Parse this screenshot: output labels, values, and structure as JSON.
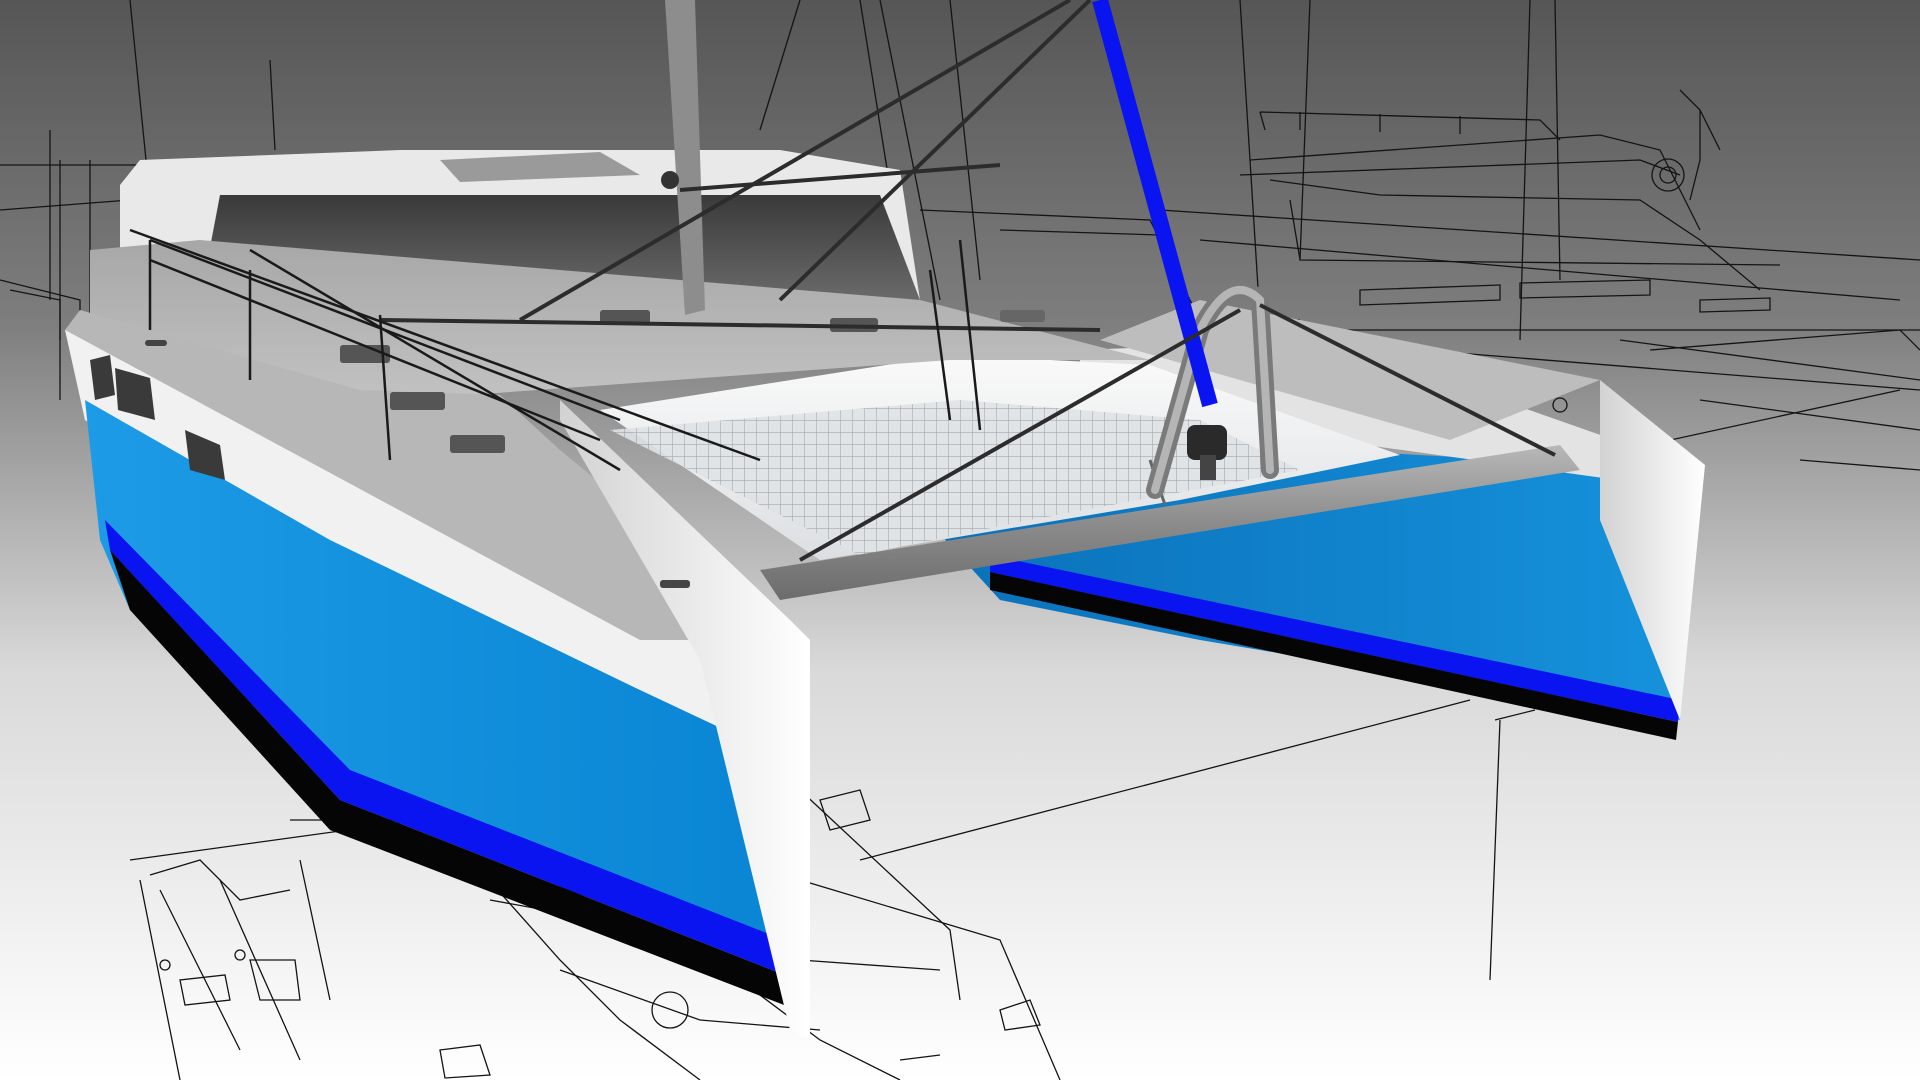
{
  "scene": {
    "subject": "catamaran-render",
    "colors": {
      "background_top": "#585858",
      "background_bottom": "#ffffff",
      "hull_blue": "#0a8ad6",
      "stripe_blue": "#0a14f0",
      "antifouling": "#050505",
      "topside_white": "#f2f2f2",
      "deck_grey": "#b0b0b0",
      "spar_grey": "#8d8d8d",
      "halyard_blue": "#0a14f0",
      "drawing_line": "#141414",
      "net": "#c9ced3"
    }
  }
}
